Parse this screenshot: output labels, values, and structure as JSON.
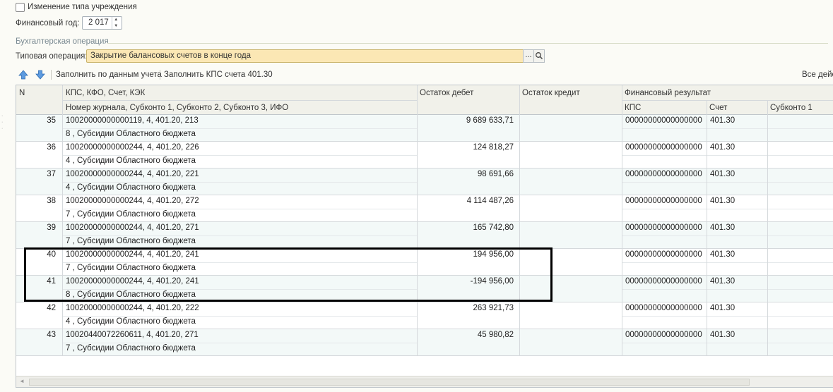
{
  "top": {
    "institution_change_label": "Изменение типа учреждения",
    "fin_year_label": "Финансовый год:",
    "fin_year_value": "2 017"
  },
  "group": {
    "title": "Бухгалтерская операция",
    "op_label": "Типовая операция:",
    "op_value": "Закрытие балансовых счетов в конце года",
    "ellipsis": "..."
  },
  "toolbar": {
    "fill_by_accounting": "Заполнить по данным учета",
    "fill_kps": "Заполнить КПС счета 401.30",
    "all_actions": "Все дейс"
  },
  "table": {
    "headers": {
      "n": "N",
      "kps_top": "КПС, КФО, Счет, КЭК",
      "kps_bottom": "Номер журнала, Субконто 1, Субконто 2, Субконто 3, ИФО",
      "debit": "Остаток дебет",
      "credit": "Остаток кредит",
      "finres": "Финансовый результат",
      "finres_kps": "КПС",
      "finres_account": "Счет",
      "finres_subconto1": "Субконто 1"
    },
    "rows": [
      {
        "n": "35",
        "line1": "10020000000000119, 4, 401.20, 213",
        "line2": "8    , Субсидии Областного бюджета",
        "debit": "9 689 633,71",
        "credit": "",
        "kps": "00000000000000000",
        "account": "401.30"
      },
      {
        "n": "36",
        "line1": "10020000000000244, 4, 401.20, 226",
        "line2": "4    , Субсидии Областного бюджета",
        "debit": "124 818,27",
        "credit": "",
        "kps": "00000000000000000",
        "account": "401.30"
      },
      {
        "n": "37",
        "line1": "10020000000000244, 4, 401.20, 221",
        "line2": "4    , Субсидии Областного бюджета",
        "debit": "98 691,66",
        "credit": "",
        "kps": "00000000000000000",
        "account": "401.30"
      },
      {
        "n": "38",
        "line1": "10020000000000244, 4, 401.20, 272",
        "line2": "7    , Субсидии Областного бюджета",
        "debit": "4 114 487,26",
        "credit": "",
        "kps": "00000000000000000",
        "account": "401.30"
      },
      {
        "n": "39",
        "line1": "10020000000000244, 4, 401.20, 271",
        "line2": "7    , Субсидии Областного бюджета",
        "debit": "165 742,80",
        "credit": "",
        "kps": "00000000000000000",
        "account": "401.30"
      },
      {
        "n": "40",
        "line1": "10020000000000244, 4, 401.20, 241",
        "line2": "7    , Субсидии Областного бюджета",
        "debit": "194 956,00",
        "credit": "",
        "kps": "00000000000000000",
        "account": "401.30"
      },
      {
        "n": "41",
        "line1": "10020000000000244, 4, 401.20, 241",
        "line2": "8    , Субсидии Областного бюджета",
        "debit": "-194 956,00",
        "credit": "",
        "kps": "00000000000000000",
        "account": "401.30"
      },
      {
        "n": "42",
        "line1": "10020000000000244, 4, 401.20, 222",
        "line2": "4    , Субсидии Областного бюджета",
        "debit": "263 921,73",
        "credit": "",
        "kps": "00000000000000000",
        "account": "401.30"
      },
      {
        "n": "43",
        "line1": "10020440072260611, 4, 401.20, 271",
        "line2": "7    , Субсидии Областного бюджета",
        "debit": "45 980,82",
        "credit": "",
        "kps": "00000000000000000",
        "account": "401.30"
      }
    ]
  },
  "colors": {
    "highlight_box": "#000000",
    "selected_field": "#fbe7b4",
    "row_alt": "#f3f9f8"
  }
}
